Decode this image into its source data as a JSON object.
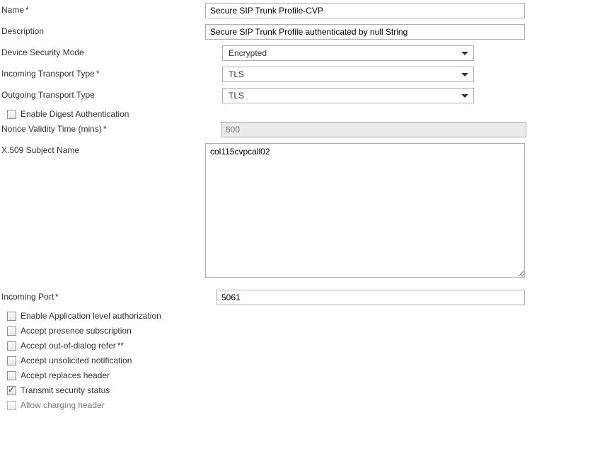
{
  "fields": {
    "name": {
      "label": "Name",
      "value": "Secure SIP Trunk Profile-CVP",
      "required": true
    },
    "description": {
      "label": "Description",
      "value": "Secure SIP Trunk Profile authenticated by null String"
    },
    "device_security_mode": {
      "label": "Device Security Mode",
      "value": "Encrypted"
    },
    "incoming_transport_type": {
      "label": "Incoming Transport Type",
      "value": "TLS",
      "required": true
    },
    "outgoing_transport_type": {
      "label": "Outgoing Transport Type",
      "value": "TLS"
    },
    "enable_digest_auth": {
      "label": "Enable Digest Authentication",
      "checked": false
    },
    "nonce_validity": {
      "label": "Nonce Validity Time (mins)",
      "value": "600",
      "required": true
    },
    "x509_subject_name": {
      "label": "X.509 Subject Name",
      "value": "col115cvpcall02"
    },
    "incoming_port": {
      "label": "Incoming Port",
      "value": "5061",
      "required": true
    },
    "enable_app_auth": {
      "label": "Enable Application level authorization",
      "checked": false
    },
    "accept_presence_sub": {
      "label": "Accept presence subscription",
      "checked": false
    },
    "accept_out_of_dialog": {
      "label": "Accept out-of-dialog refer",
      "checked": false
    },
    "accept_unsolicited": {
      "label": "Accept unsolicited notification",
      "checked": false
    },
    "accept_replaces": {
      "label": "Accept replaces header",
      "checked": false
    },
    "transmit_security": {
      "label": "Transmit security status",
      "checked": true
    },
    "allow_charging": {
      "label": "Allow charging header",
      "checked": false
    }
  }
}
